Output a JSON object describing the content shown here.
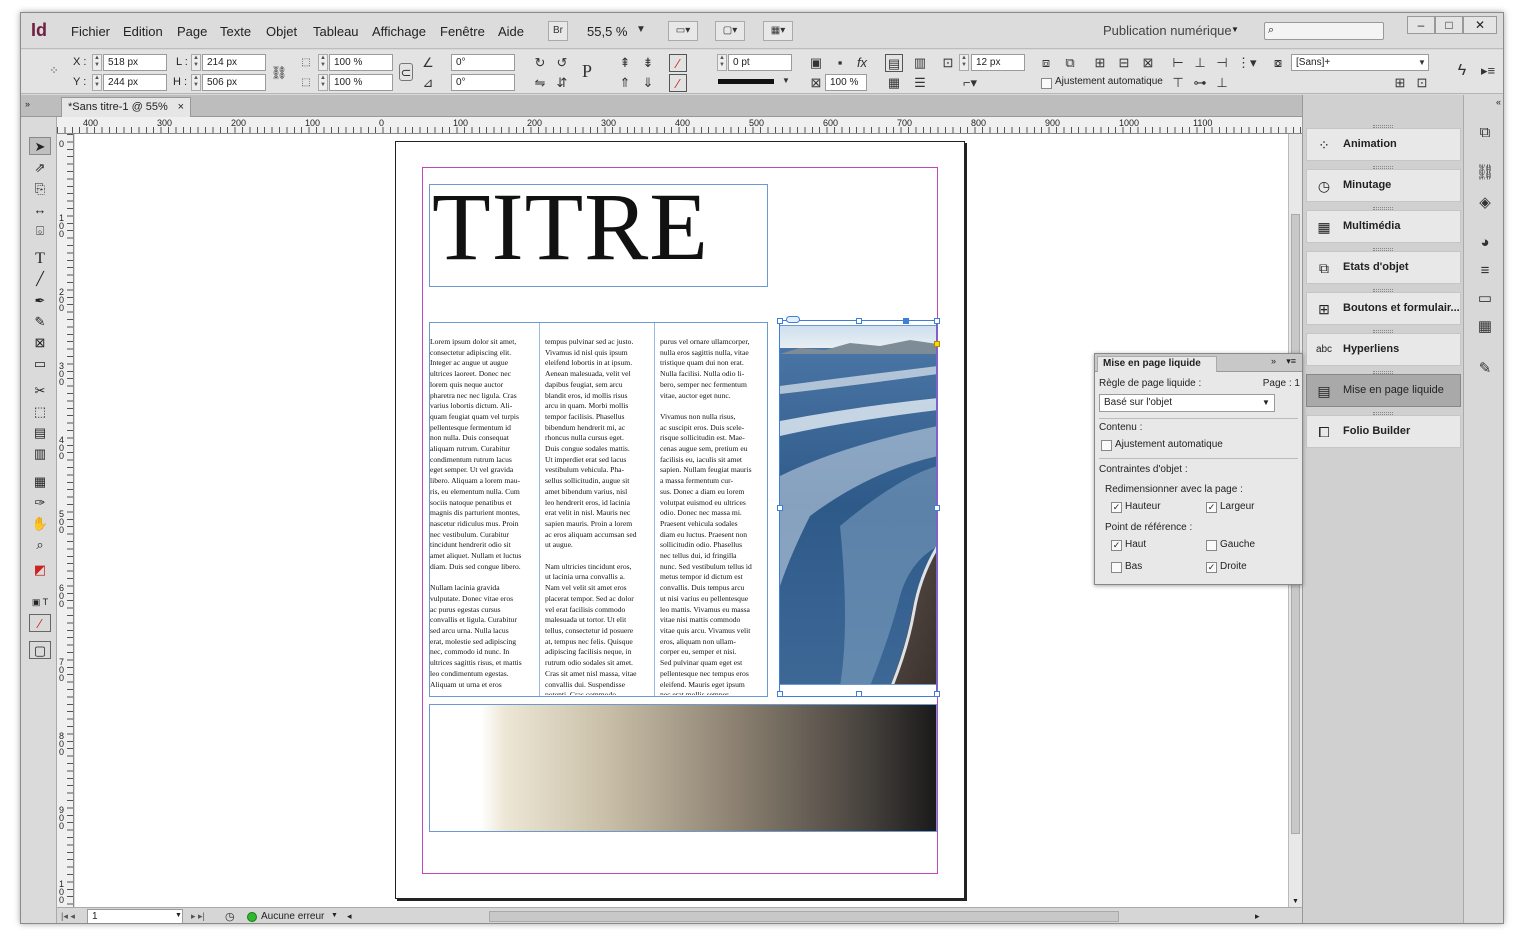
{
  "app": {
    "logo": "Id"
  },
  "menu": [
    "Fichier",
    "Edition",
    "Page",
    "Texte",
    "Objet",
    "Tableau",
    "Affichage",
    "Fenêtre",
    "Aide"
  ],
  "menubar": {
    "bridge_label": "Br",
    "zoom": "55,5 %",
    "workspace": "Publication numérique"
  },
  "control": {
    "x_label": "X :",
    "x_value": "518 px",
    "y_label": "Y :",
    "y_value": "244 px",
    "w_label": "L :",
    "w_value": "214 px",
    "h_label": "H :",
    "h_value": "506 px",
    "scale_x": "100 %",
    "scale_y": "100 %",
    "rotate": "0°",
    "shear": "0°",
    "stroke_weight": "0 pt",
    "opacity": "100 %",
    "gutter": "12 px",
    "auto_fit_label": "Ajustement automatique",
    "font_style": "[Sans]+"
  },
  "document_tab": {
    "title": "*Sans titre-1 @ 55%",
    "close": "×"
  },
  "hruler_labels": [
    "400",
    "300",
    "200",
    "100",
    "0",
    "100",
    "200",
    "300",
    "400",
    "500",
    "600",
    "700",
    "800",
    "900",
    "1000",
    "1100"
  ],
  "vruler_labels": [
    "0",
    "100",
    "200",
    "300",
    "400",
    "500",
    "600",
    "700",
    "800",
    "900",
    "100"
  ],
  "document": {
    "title": "TITRE",
    "col1": "Lorem ipsum dolor sit amet,\nconsectetur adipiscing elit.\nInteger ac augue ut augue\nultrices laoreet. Donec nec\nlorem quis neque auctor\npharetra nec nec ligula. Cras\nvarius lobortis dictum. Ali-\nquam feugiat quam vel turpis\npellentesque fermentum id\nnon nulla. Duis consequat\naliquam rutrum. Curabitur\ncondimentum rutrum lacus\neget semper. Ut vel gravida\nlibero. Aliquam a lorem mau-\nris, eu elementum nulla. Cum\nsociis natoque penatibus et\nmagnis dis parturient montes,\nnascetur ridiculus mus. Proin\nnec vestibulum. Curabitur\ntincidunt hendrerit odio sit\namet aliquet. Nullam et luctus\ndiam. Duis sed congue libero.\n\nNullam lacinia gravida\nvulputate. Donec vitae eros\nac purus egestas cursus\nconvallis et ligula. Curabitur\nsed arcu urna. Nulla lacus\nerat, molestie sed adipiscing\nnec, commodo id nunc. In\nultrices sagittis risus, et mattis\nleo condimentum egestas.\nAliquam ut urna et eros",
    "col2": "tempus pulvinar sed ac justo.\nVivamus id nisl quis ipsum\neleifend lobortis in at ipsum.\nAenean malesuada, velit vel\ndapibus feugiat, sem arcu\nblandit eros, id mollis risus\narcu in quam. Morbi mollis\ntempor facilisis. Phasellus\nbibendum hendrerit mi, ac\nrhoncus nulla cursus eget.\nDuis congue sodales mattis.\nUt imperdiet erat sed lacus\nvestibulum vehicula. Pha-\nsellus sollicitudin, augue sit\namet bibendum varius, nisl\nleo hendrerit eros, id lacinia\nerat velit in nisl. Mauris nec\nsapien mauris. Proin a lorem\nac eros aliquam accumsan sed\nut augue.\n\nNam ultricies tincidunt eros,\nut lacinia urna convallis a.\nNam vel velit sit amet eros\nplacerat tempor. Sed ac dolor\nvel erat facilisis commodo\nmalesuada ut tortor. Ut elit\ntellus, consectetur id posuere\nat, tempus nec felis. Quisque\nadipiscing facilisis neque, in\nrutrum odio sodales sit amet.\nCras sit amet nisl massa, vitae\nconvallis dui. Suspendisse\npotenti. Cras commodo,",
    "col3": "purus vel ornare ullamcorper,\nnulla eros sagittis nulla, vitae\ntristique quam dui non erat.\nNulla facilisi. Nulla odio li-\nbero, semper nec fermentum\nvitae, auctor eget nunc.\n\nVivamus non nulla risus,\nac suscipit eros. Duis scele-\nrisque sollicitudin est. Mae-\ncenas augue sem, pretium eu\nfacilisis eu, iaculis sit amet\nsapien. Nullam feugiat mauris\na massa fermentum cur-\nsus. Donec a diam eu lorem\nvolutpat euismod eu ultrices\nodio. Donec nec massa mi.\nPraesent vehicula sodales\ndiam eu luctus. Praesent non\nsollicitudin odio. Phasellus\nnec tellus dui, id fringilla\nnunc. Sed vestibulum tellus id\nmetus tempor id dictum est\nconvallis. Duis tempus arcu\nut nisi varius eu pellentesque\nleo mattis. Vivamus eu massa\nvitae nisi mattis commodo\nvitae quis arcu. Vivamus velit\neros, aliquam non ullam-\ncorper eu, semper et nisi.\nSed pulvinar quam eget est\npellentesque nec tempus eros\neleifend. Mauris eget ipsum\nnec erat mollis semper"
  },
  "status": {
    "page": "1",
    "errors": "Aucune erreur"
  },
  "panels": [
    {
      "label": "Animation",
      "icon": "animation-icon"
    },
    {
      "label": "Minutage",
      "icon": "timing-icon"
    },
    {
      "label": "Multimédia",
      "icon": "media-icon"
    },
    {
      "label": "Etats d'objet",
      "icon": "object-states-icon"
    },
    {
      "label": "Boutons et formulair...",
      "icon": "buttons-icon"
    },
    {
      "label": "Hyperliens",
      "icon": "hyperlinks-icon"
    },
    {
      "label": "Mise en page liquide",
      "icon": "liquid-layout-icon"
    },
    {
      "label": "Folio Builder",
      "icon": "folio-icon"
    }
  ],
  "liquid_panel": {
    "tab": "Mise en page liquide",
    "rule_label": "Règle de page liquide :",
    "page_label": "Page : 1",
    "rule_value": "Basé sur l'objet",
    "content_label": "Contenu :",
    "auto_fit": "Ajustement automatique",
    "constraints_label": "Contraintes d'objet :",
    "resize_label": "Redimensionner avec la page :",
    "height": "Hauteur",
    "width": "Largeur",
    "ref_label": "Point de référence :",
    "top": "Haut",
    "left": "Gauche",
    "bottom": "Bas",
    "right": "Droite"
  },
  "colors": {
    "accent": "#3d7fd8",
    "margin": "#c045c0",
    "frame": "#6a9ad0",
    "logo": "#6e2040"
  }
}
